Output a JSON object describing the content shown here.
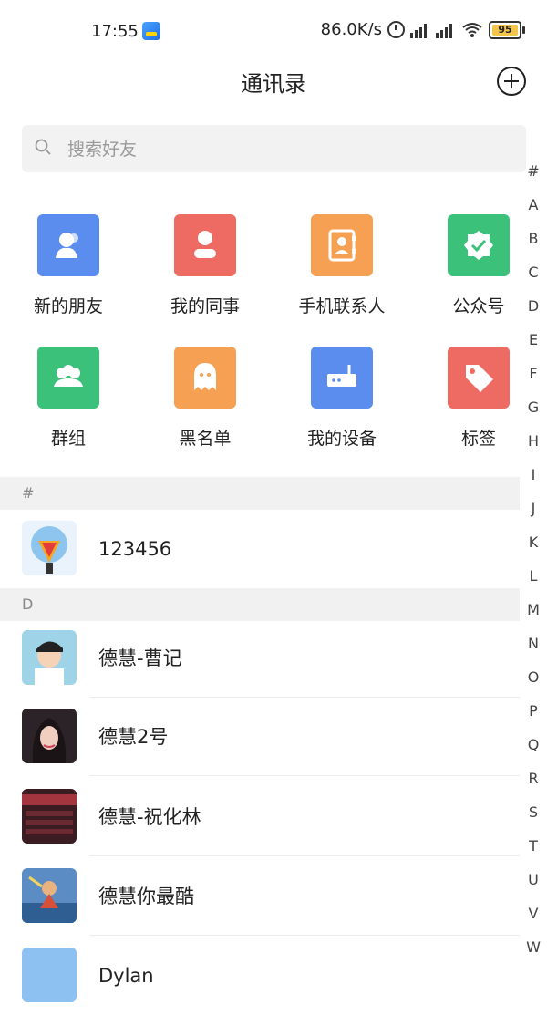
{
  "status": {
    "time": "17:55",
    "speed": "86.0K/s",
    "battery": "95"
  },
  "header": {
    "title": "通讯录"
  },
  "search": {
    "placeholder": "搜索好友"
  },
  "functions": [
    {
      "label": "新的朋友",
      "color": "#5b8dee",
      "icon": "new-friend-icon"
    },
    {
      "label": "我的同事",
      "color": "#ee6b63",
      "icon": "colleague-icon"
    },
    {
      "label": "手机联系人",
      "color": "#f5a053",
      "icon": "phone-contacts-icon"
    },
    {
      "label": "公众号",
      "color": "#3bc17a",
      "icon": "official-account-icon"
    },
    {
      "label": "群组",
      "color": "#3bc17a",
      "icon": "group-icon"
    },
    {
      "label": "黑名单",
      "color": "#f5a053",
      "icon": "blacklist-icon"
    },
    {
      "label": "我的设备",
      "color": "#5b8dee",
      "icon": "device-icon"
    },
    {
      "label": "标签",
      "color": "#ee6b63",
      "icon": "tag-icon"
    }
  ],
  "sections": [
    {
      "letter": "#",
      "contacts": [
        {
          "name": "123456"
        }
      ]
    },
    {
      "letter": "D",
      "contacts": [
        {
          "name": "德慧-曹记"
        },
        {
          "name": "德慧2号"
        },
        {
          "name": "德慧-祝化林"
        },
        {
          "name": "德慧你最酷"
        },
        {
          "name": "Dylan"
        }
      ]
    }
  ],
  "index": [
    "#",
    "A",
    "B",
    "C",
    "D",
    "E",
    "F",
    "G",
    "H",
    "I",
    "J",
    "K",
    "L",
    "M",
    "N",
    "O",
    "P",
    "Q",
    "R",
    "S",
    "T",
    "U",
    "V",
    "W"
  ]
}
